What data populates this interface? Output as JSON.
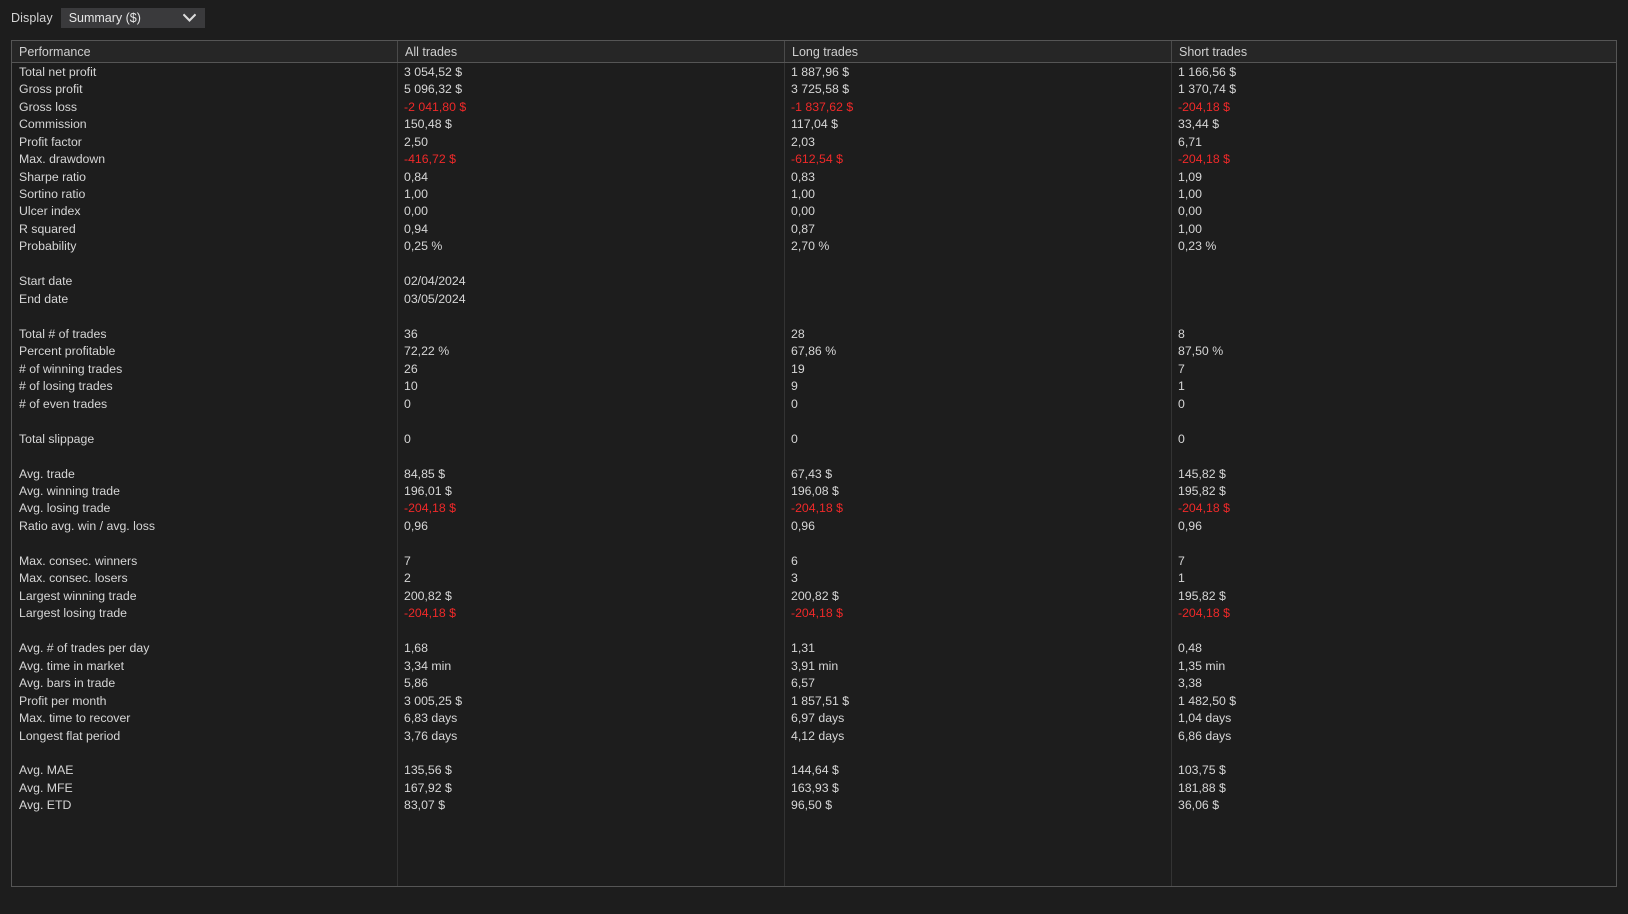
{
  "toolbar": {
    "display_label": "Display",
    "display_value": "Summary ($)",
    "chevron_icon": "chevron-down-icon"
  },
  "table": {
    "columns": [
      "Performance",
      "All trades",
      "Long trades",
      "Short trades"
    ],
    "negative_color": "#ef2929",
    "text_color": "#d6d6d6",
    "rows": [
      {
        "label": "Total net profit",
        "all": "3 054,52 $",
        "long": "1 887,96 $",
        "short": "1 166,56 $",
        "neg": [
          false,
          false,
          false
        ]
      },
      {
        "label": "Gross profit",
        "all": "5 096,32 $",
        "long": "3 725,58 $",
        "short": "1 370,74 $",
        "neg": [
          false,
          false,
          false
        ]
      },
      {
        "label": "Gross loss",
        "all": "-2 041,80 $",
        "long": "-1 837,62 $",
        "short": "-204,18 $",
        "neg": [
          true,
          true,
          true
        ]
      },
      {
        "label": "Commission",
        "all": "150,48 $",
        "long": "117,04 $",
        "short": "33,44 $",
        "neg": [
          false,
          false,
          false
        ]
      },
      {
        "label": "Profit factor",
        "all": "2,50",
        "long": "2,03",
        "short": "6,71",
        "neg": [
          false,
          false,
          false
        ]
      },
      {
        "label": "Max. drawdown",
        "all": "-416,72 $",
        "long": "-612,54 $",
        "short": "-204,18 $",
        "neg": [
          true,
          true,
          true
        ]
      },
      {
        "label": "Sharpe ratio",
        "all": "0,84",
        "long": "0,83",
        "short": "1,09",
        "neg": [
          false,
          false,
          false
        ]
      },
      {
        "label": "Sortino ratio",
        "all": "1,00",
        "long": "1,00",
        "short": "1,00",
        "neg": [
          false,
          false,
          false
        ]
      },
      {
        "label": "Ulcer index",
        "all": "0,00",
        "long": "0,00",
        "short": "0,00",
        "neg": [
          false,
          false,
          false
        ]
      },
      {
        "label": "R squared",
        "all": "0,94",
        "long": "0,87",
        "short": "1,00",
        "neg": [
          false,
          false,
          false
        ]
      },
      {
        "label": "Probability",
        "all": "0,25 %",
        "long": "2,70 %",
        "short": "0,23 %",
        "neg": [
          false,
          false,
          false
        ]
      },
      {
        "spacer": true
      },
      {
        "label": "Start date",
        "all": "02/04/2024",
        "long": "",
        "short": "",
        "neg": [
          false,
          false,
          false
        ]
      },
      {
        "label": "End date",
        "all": "03/05/2024",
        "long": "",
        "short": "",
        "neg": [
          false,
          false,
          false
        ]
      },
      {
        "spacer": true
      },
      {
        "label": "Total # of trades",
        "all": "36",
        "long": "28",
        "short": "8",
        "neg": [
          false,
          false,
          false
        ]
      },
      {
        "label": "Percent profitable",
        "all": "72,22 %",
        "long": "67,86 %",
        "short": "87,50 %",
        "neg": [
          false,
          false,
          false
        ]
      },
      {
        "label": "# of winning trades",
        "all": "26",
        "long": "19",
        "short": "7",
        "neg": [
          false,
          false,
          false
        ]
      },
      {
        "label": "# of losing trades",
        "all": "10",
        "long": "9",
        "short": "1",
        "neg": [
          false,
          false,
          false
        ]
      },
      {
        "label": "# of even trades",
        "all": "0",
        "long": "0",
        "short": "0",
        "neg": [
          false,
          false,
          false
        ]
      },
      {
        "spacer": true
      },
      {
        "label": "Total slippage",
        "all": "0",
        "long": "0",
        "short": "0",
        "neg": [
          false,
          false,
          false
        ]
      },
      {
        "spacer": true
      },
      {
        "label": "Avg. trade",
        "all": "84,85 $",
        "long": "67,43 $",
        "short": "145,82 $",
        "neg": [
          false,
          false,
          false
        ]
      },
      {
        "label": "Avg. winning trade",
        "all": "196,01 $",
        "long": "196,08 $",
        "short": "195,82 $",
        "neg": [
          false,
          false,
          false
        ]
      },
      {
        "label": "Avg. losing trade",
        "all": "-204,18 $",
        "long": "-204,18 $",
        "short": "-204,18 $",
        "neg": [
          true,
          true,
          true
        ]
      },
      {
        "label": "Ratio avg. win / avg. loss",
        "all": "0,96",
        "long": "0,96",
        "short": "0,96",
        "neg": [
          false,
          false,
          false
        ]
      },
      {
        "spacer": true
      },
      {
        "label": "Max. consec. winners",
        "all": "7",
        "long": "6",
        "short": "7",
        "neg": [
          false,
          false,
          false
        ]
      },
      {
        "label": "Max. consec. losers",
        "all": "2",
        "long": "3",
        "short": "1",
        "neg": [
          false,
          false,
          false
        ]
      },
      {
        "label": "Largest winning trade",
        "all": "200,82 $",
        "long": "200,82 $",
        "short": "195,82 $",
        "neg": [
          false,
          false,
          false
        ]
      },
      {
        "label": "Largest losing trade",
        "all": "-204,18 $",
        "long": "-204,18 $",
        "short": "-204,18 $",
        "neg": [
          true,
          true,
          true
        ]
      },
      {
        "spacer": true
      },
      {
        "label": "Avg. # of trades per day",
        "all": "1,68",
        "long": "1,31",
        "short": "0,48",
        "neg": [
          false,
          false,
          false
        ]
      },
      {
        "label": "Avg. time in market",
        "all": "3,34 min",
        "long": "3,91 min",
        "short": "1,35 min",
        "neg": [
          false,
          false,
          false
        ]
      },
      {
        "label": "Avg. bars in trade",
        "all": "5,86",
        "long": "6,57",
        "short": "3,38",
        "neg": [
          false,
          false,
          false
        ]
      },
      {
        "label": "Profit per month",
        "all": "3 005,25 $",
        "long": "1 857,51 $",
        "short": "1 482,50 $",
        "neg": [
          false,
          false,
          false
        ]
      },
      {
        "label": "Max. time to recover",
        "all": "6,83 days",
        "long": "6,97 days",
        "short": "1,04 days",
        "neg": [
          false,
          false,
          false
        ]
      },
      {
        "label": "Longest flat period",
        "all": "3,76 days",
        "long": "4,12 days",
        "short": "6,86 days",
        "neg": [
          false,
          false,
          false
        ]
      },
      {
        "spacer": true
      },
      {
        "label": "Avg. MAE",
        "all": "135,56 $",
        "long": "144,64 $",
        "short": "103,75 $",
        "neg": [
          false,
          false,
          false
        ]
      },
      {
        "label": "Avg. MFE",
        "all": "167,92 $",
        "long": "163,93 $",
        "short": "181,88 $",
        "neg": [
          false,
          false,
          false
        ]
      },
      {
        "label": "Avg. ETD",
        "all": "83,07 $",
        "long": "96,50 $",
        "short": "36,06 $",
        "neg": [
          false,
          false,
          false
        ]
      }
    ]
  }
}
